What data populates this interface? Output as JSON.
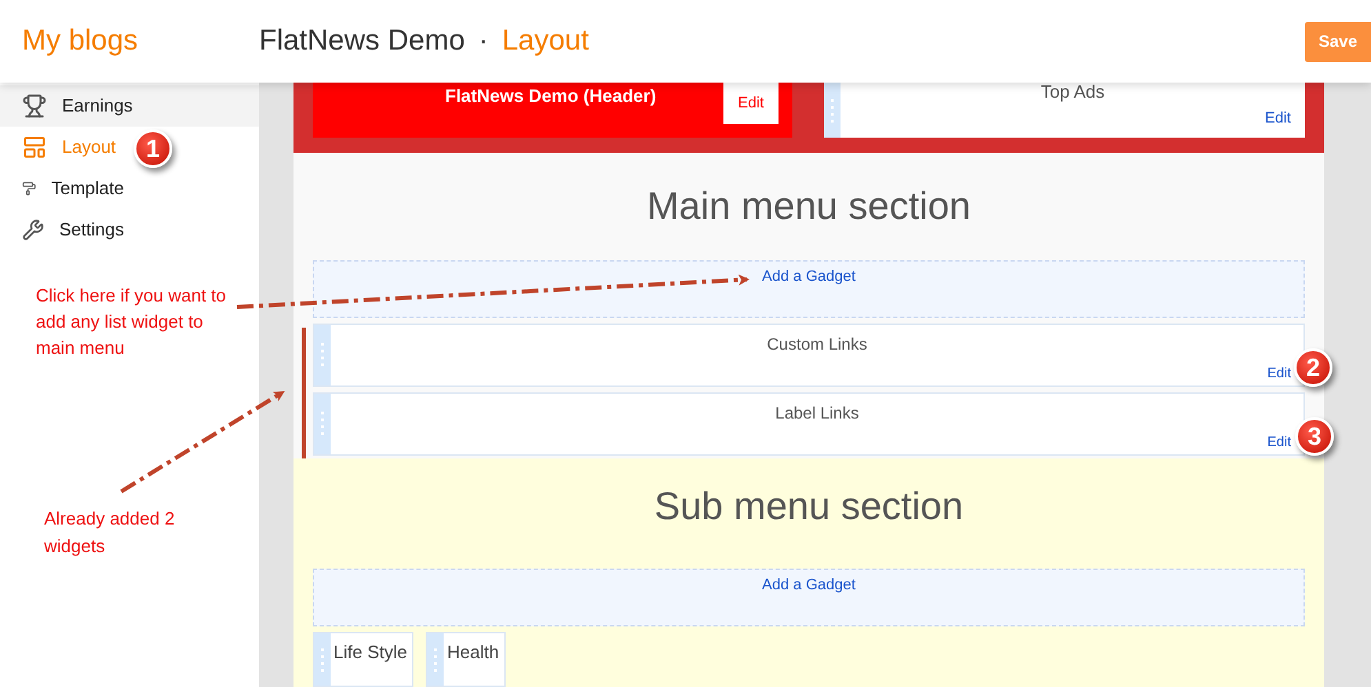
{
  "header": {
    "brand": "My blogs",
    "blog_title": "FlatNews Demo",
    "separator": "·",
    "page": "Layout",
    "save_button": "Save"
  },
  "sidebar": {
    "items": [
      {
        "label": "Earnings",
        "selected": false,
        "highlighted": true
      },
      {
        "label": "Layout",
        "selected": true,
        "highlighted": false
      },
      {
        "label": "Template",
        "selected": false,
        "highlighted": false
      },
      {
        "label": "Settings",
        "selected": false,
        "highlighted": false
      }
    ]
  },
  "top_section": {
    "header_widget": {
      "title": "FlatNews Demo (Header)",
      "edit": "Edit"
    },
    "ads_widget": {
      "title": "Top Ads",
      "edit": "Edit"
    }
  },
  "main_menu": {
    "title": "Main menu section",
    "add_gadget": "Add a Gadget",
    "widgets": [
      {
        "title": "Custom Links",
        "edit": "Edit"
      },
      {
        "title": "Label Links",
        "edit": "Edit"
      }
    ]
  },
  "sub_menu": {
    "title": "Sub menu section",
    "add_gadget": "Add a Gadget",
    "widgets": [
      {
        "title": "Life Style"
      },
      {
        "title": "Health"
      }
    ]
  },
  "annotations": {
    "steps": [
      "1",
      "2",
      "3"
    ],
    "notes": [
      "Click here if you want to add any list widget to main menu",
      "Already added 2 widgets"
    ]
  }
}
